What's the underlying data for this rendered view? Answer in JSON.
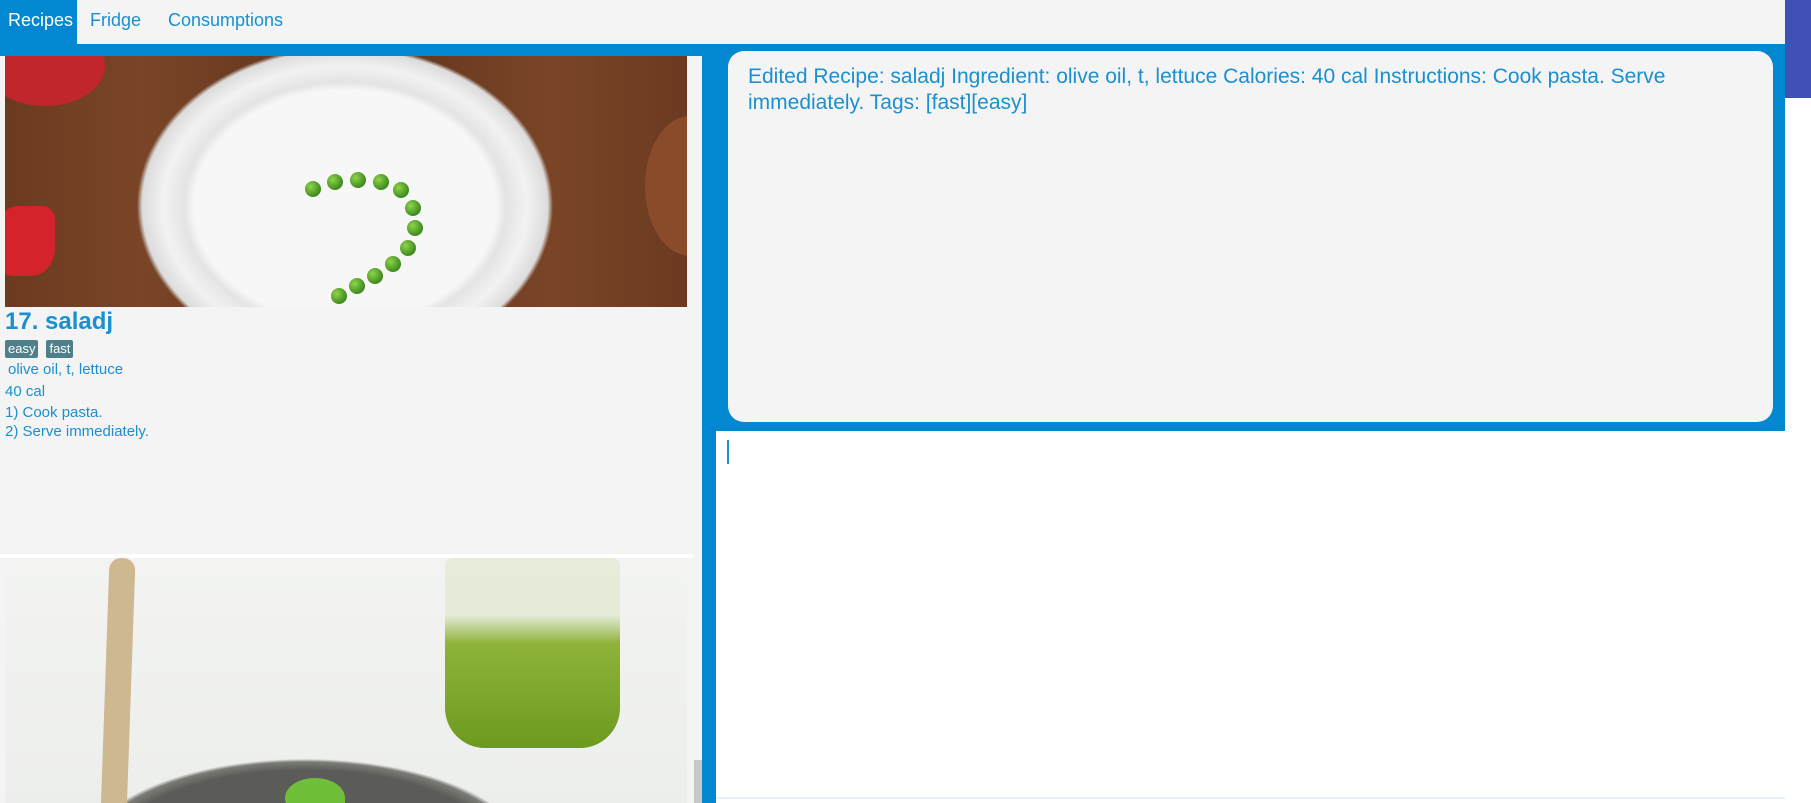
{
  "tabs": [
    {
      "label": "Recipes",
      "active": true
    },
    {
      "label": "Fridge",
      "active": false
    },
    {
      "label": "Consumptions",
      "active": false
    }
  ],
  "recipe": {
    "title": "17.  saladj",
    "tags": [
      "easy",
      "fast"
    ],
    "ingredients": " olive oil,  t,  lettuce",
    "calories": "40 cal",
    "steps": [
      "1) Cook pasta.",
      "2) Serve immediately."
    ]
  },
  "result_display": {
    "text": "Edited Recipe: saladj Ingredient:  olive oil,  t,  lettuce Calories: 40 cal Instructions: Cook pasta.  Serve immediately. Tags: [fast][easy]"
  },
  "command_box": {
    "value": ""
  },
  "colors": {
    "accent": "#0288d1",
    "panel": "#f4f4f4",
    "text": "#1a8fd1",
    "tag": "#4f7f8a"
  }
}
